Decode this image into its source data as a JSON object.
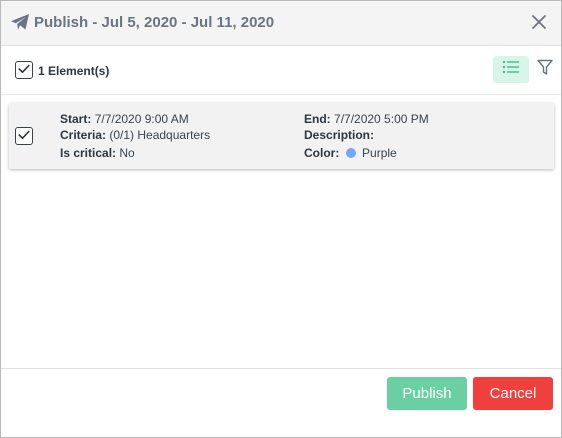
{
  "dialog": {
    "title": "Publish - Jul 5, 2020 - Jul 11, 2020"
  },
  "toolbar": {
    "count_label": "1 Element(s)",
    "select_all_checked": true
  },
  "items": [
    {
      "checked": true,
      "start_label": "Start:",
      "start_value": "7/7/2020 9:00 AM",
      "criteria_label": "Criteria:",
      "criteria_value": "(0/1) Headquarters",
      "critical_label": "Is critical:",
      "critical_value": "No",
      "end_label": "End:",
      "end_value": "7/7/2020 5:00 PM",
      "description_label": "Description:",
      "description_value": "",
      "color_label": "Color:",
      "color_value": "Purple",
      "color_dot": "#73a6ff"
    }
  ],
  "footer": {
    "publish_label": "Publish",
    "cancel_label": "Cancel"
  },
  "colors": {
    "publish_bg": "#6ad0a4",
    "cancel_bg": "#f0403e",
    "view_toggle_bg": "#d8f5e9",
    "icon_green": "#3fbf86"
  }
}
